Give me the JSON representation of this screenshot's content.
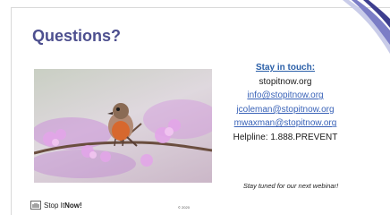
{
  "slide": {
    "title": "Questions?",
    "contact": {
      "heading": "Stay in touch:",
      "website": "stopitnow.org",
      "emails": [
        "info@stopitnow.org",
        "jcoleman@stopitnow.org",
        "mwaxman@stopitnow.org"
      ],
      "helpline": "Helpline: 1.888.PREVENT"
    },
    "webinar_note": "Stay tuned for our next webinar!",
    "logo": {
      "text_regular": "Stop It ",
      "text_bold": "Now!"
    },
    "copyright": "© 2020"
  },
  "colors": {
    "title": "#4d4f8f",
    "heading": "#2a5fa8",
    "link": "#3a63b8",
    "swoosh_dark": "#3e3f8f",
    "swoosh_mid": "#7b7dc6",
    "swoosh_light": "#c9cce9"
  },
  "icons": {
    "photo": "robin-on-blossom-branch",
    "logo": "hand-stop-icon"
  }
}
